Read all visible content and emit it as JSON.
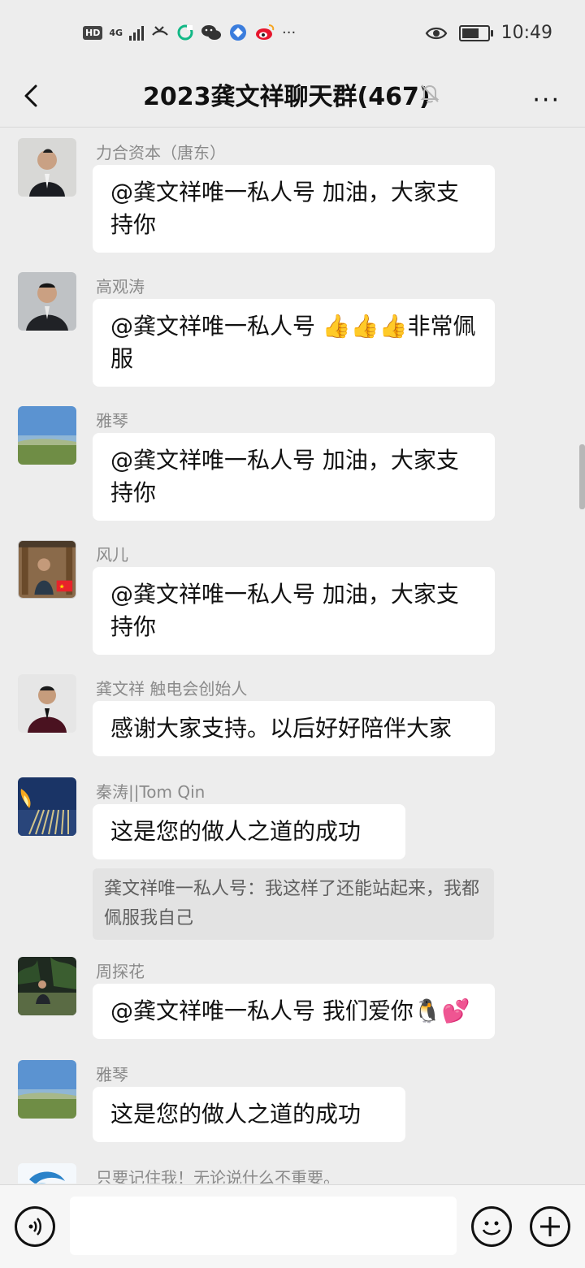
{
  "status_bar": {
    "network": "4G",
    "hd_label": "HD",
    "more": "···",
    "time": "10:49",
    "icons": [
      "hd-icon",
      "signal-icon",
      "missed-call-icon",
      "app-green-icon",
      "wechat-icon",
      "browser-icon",
      "weibo-icon",
      "eye-icon",
      "battery-icon"
    ]
  },
  "nav": {
    "title": "2023龚文祥聊天群(467)",
    "more_label": "···",
    "icons": [
      "back-icon",
      "mute-bell-icon",
      "more-icon"
    ]
  },
  "messages": [
    {
      "sender": "力合资本（唐东）",
      "text": "@龚文祥唯一私人号  加油，大家支持你"
    },
    {
      "sender": "高观涛",
      "text": "@龚文祥唯一私人号 👍👍👍非常佩服"
    },
    {
      "sender": "雅琴",
      "text": "@龚文祥唯一私人号  加油，大家支持你"
    },
    {
      "sender": "风儿",
      "text": "@龚文祥唯一私人号  加油，大家支持你"
    },
    {
      "sender": "龚文祥 触电会创始人",
      "text": "感谢大家支持。以后好好陪伴大家"
    },
    {
      "sender": "秦涛||Tom Qin",
      "text": "这是您的做人之道的成功",
      "quote": "龚文祥唯一私人号：我这样了还能站起来，我都佩服我自己"
    },
    {
      "sender": "周探花",
      "text": "@龚文祥唯一私人号  我们爱你🐧💕"
    },
    {
      "sender": "雅琴",
      "text": "这是您的做人之道的成功"
    },
    {
      "sender": "只要记住我！无论说什么不重要。",
      "text": ""
    }
  ],
  "input": {
    "value": "",
    "placeholder": "",
    "icons": [
      "voice-icon",
      "emoji-icon",
      "plus-icon"
    ]
  }
}
